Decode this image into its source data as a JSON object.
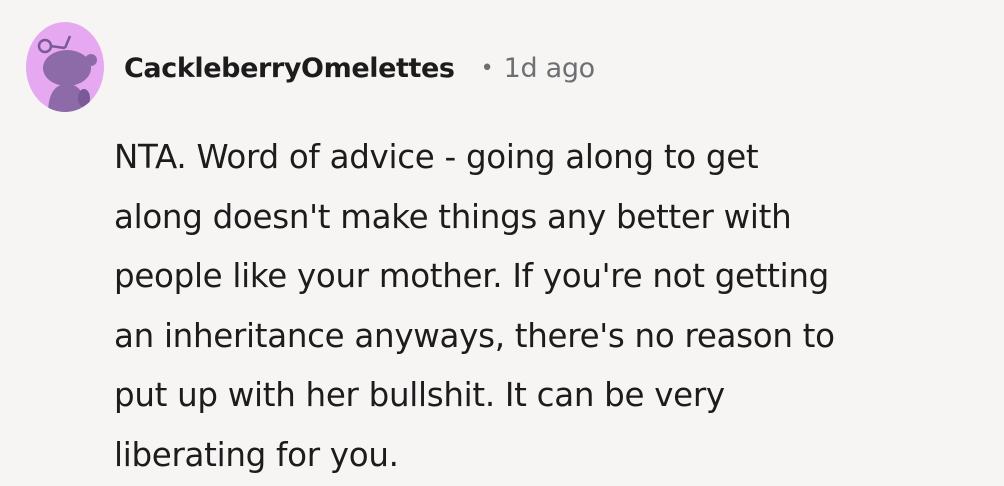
{
  "comment": {
    "avatar_icon": "snoo-avatar-icon",
    "avatar_color": "#e5a8f1",
    "username": "CackleberryOmelettes",
    "separator": "•",
    "timestamp": "1d ago",
    "body_lines": [
      "NTA. Word of advice - going along to get",
      "along doesn't make things any better with",
      "people like your mother. If you're not getting",
      "an inheritance anyways, there's no reason to",
      "put up with her bullshit. It can be very",
      "liberating for you."
    ]
  }
}
